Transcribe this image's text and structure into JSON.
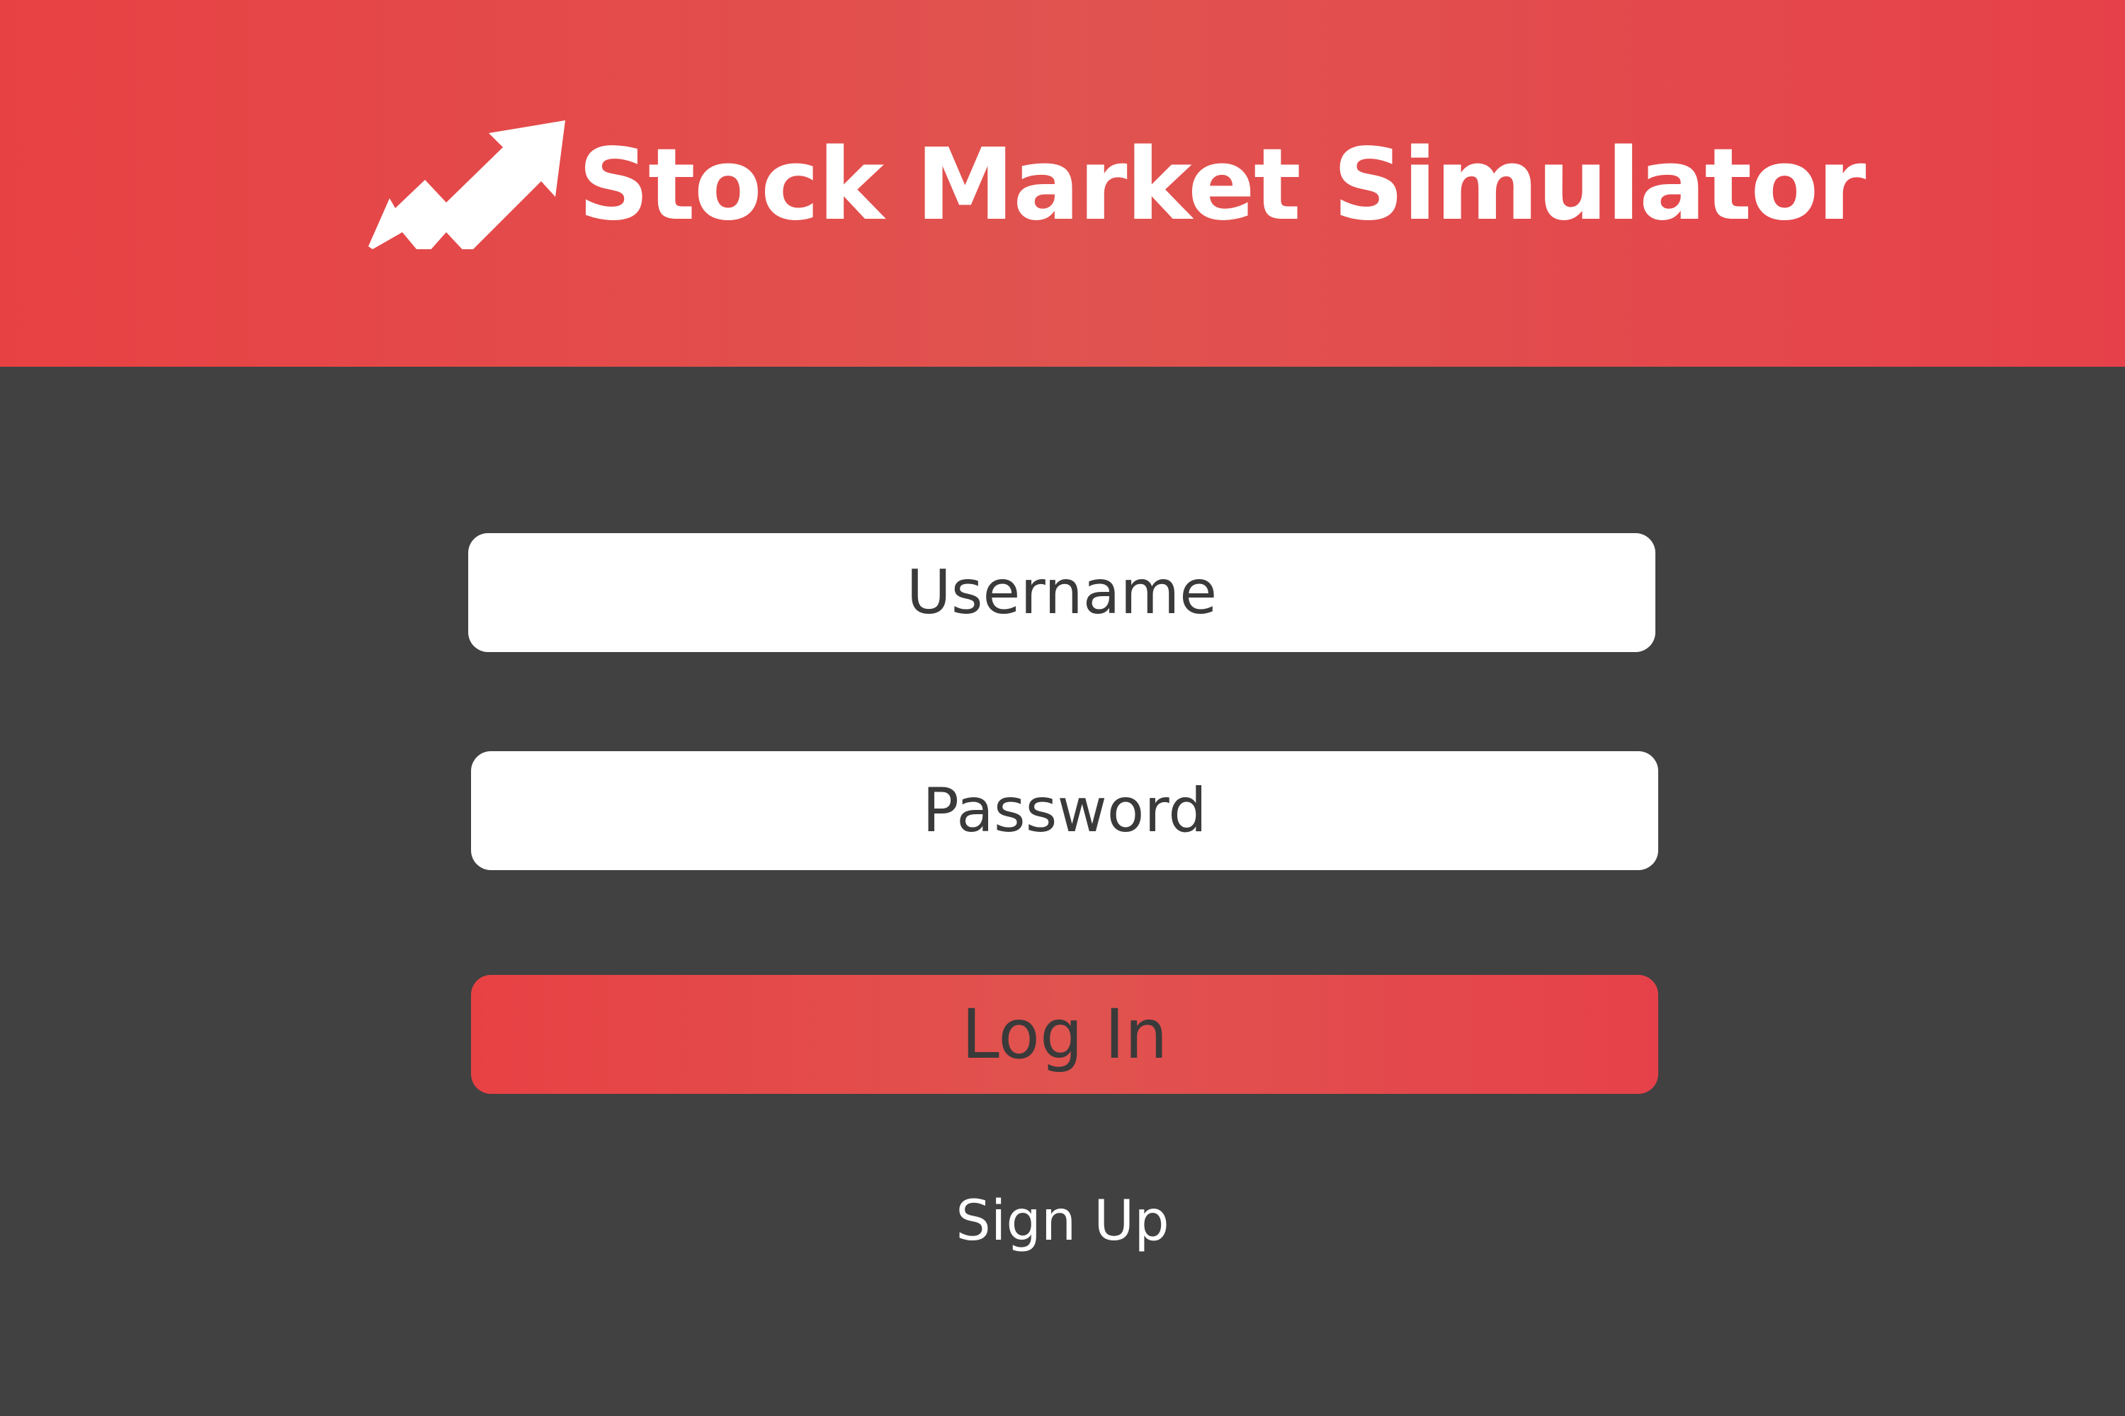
{
  "app": {
    "title": "Stock Market Simulator",
    "logo_icon": "trending-up-arrow-icon"
  },
  "colors": {
    "accent": "#e84144",
    "background": "#414141",
    "field_background": "#ffffff",
    "field_text": "#3a3a3a",
    "link_text": "#ffffff"
  },
  "login_form": {
    "username_placeholder": "Username",
    "password_placeholder": "Password",
    "login_label": "Log In",
    "signup_label": "Sign Up"
  }
}
